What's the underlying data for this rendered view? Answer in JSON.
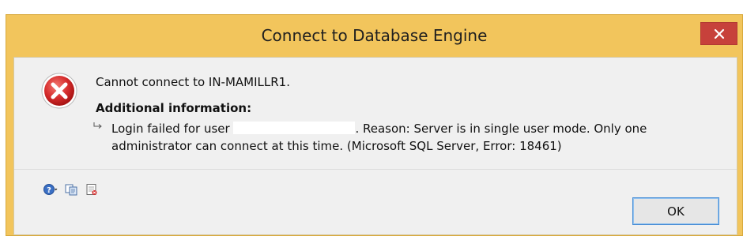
{
  "window": {
    "title": "Connect to Database Engine",
    "close_icon": "close-icon"
  },
  "message": {
    "icon": "error-icon",
    "main": "Cannot connect to IN-MAMILLR1.",
    "additional_heading": "Additional information:",
    "detail_prefix": "Login failed for user",
    "detail_suffix": ". Reason: Server is in single user mode. Only one administrator can connect at this time. (Microsoft SQL Server, Error: 18461)"
  },
  "toolbar": {
    "icons": [
      "help-icon",
      "copy-icon",
      "details-icon"
    ]
  },
  "buttons": {
    "ok_label": "OK"
  },
  "colors": {
    "title_bar": "#f2c55c",
    "close_button": "#c7413b",
    "client_bg": "#f0f0f0",
    "error_red": "#d62d2d",
    "ok_border": "#4a8fd6"
  }
}
